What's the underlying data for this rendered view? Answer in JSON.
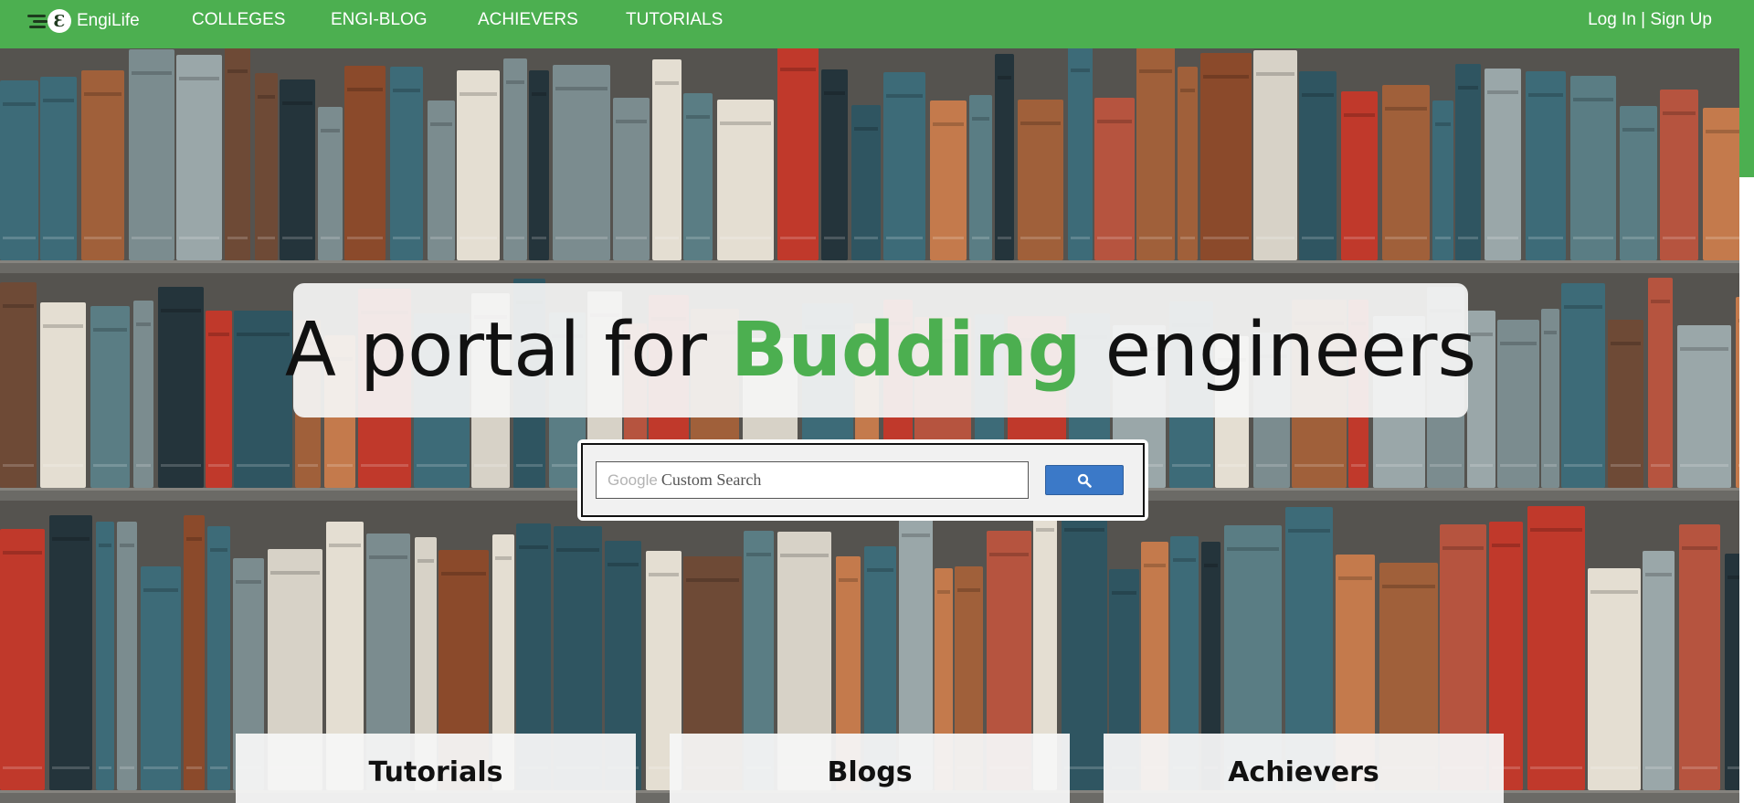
{
  "brand": {
    "name": "EngiLife",
    "logo_glyph": "Ɛ"
  },
  "nav": {
    "links": [
      "COLLEGES",
      "ENGI-BLOG",
      "ACHIEVERS",
      "TUTORIALS"
    ],
    "auth": {
      "login": "Log In",
      "separator": " | ",
      "signup": "Sign Up"
    }
  },
  "hero": {
    "headline_before": "A portal for ",
    "headline_accent": "Budding",
    "headline_after": " engineers"
  },
  "search": {
    "brand_text": "Google",
    "placeholder": "Custom Search",
    "button_icon": "search-icon"
  },
  "cards": [
    "Tutorials",
    "Blogs",
    "Achievers"
  ],
  "colors": {
    "primary": "#4caf50",
    "search_button": "#3b79c8",
    "headline_text": "#111111"
  }
}
